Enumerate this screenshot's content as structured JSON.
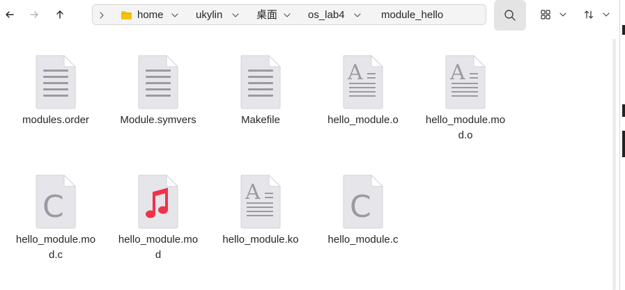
{
  "toolbar": {
    "back_icon": "arrow-left-icon",
    "forward_icon": "arrow-right-icon",
    "up_icon": "arrow-up-icon",
    "search_icon": "search-icon",
    "view_icon": "grid-view-icon",
    "sort_icon": "sort-icon"
  },
  "breadcrumb": {
    "items": [
      {
        "label": "home"
      },
      {
        "label": "ukylin"
      },
      {
        "label": "桌面"
      },
      {
        "label": "os_lab4"
      },
      {
        "label": "module_hello"
      }
    ]
  },
  "files": [
    {
      "name": "modules.order",
      "icon": "text-document-icon"
    },
    {
      "name": "Module.symvers",
      "icon": "text-document-icon"
    },
    {
      "name": "Makefile",
      "icon": "text-document-icon"
    },
    {
      "name": "hello_module.o",
      "icon": "object-file-icon"
    },
    {
      "name": "hello_module.mod.o",
      "icon": "object-file-icon"
    },
    {
      "name": "hello_module.mod.c",
      "icon": "c-source-icon"
    },
    {
      "name": "hello_module.mod",
      "icon": "music-file-icon"
    },
    {
      "name": "hello_module.ko",
      "icon": "object-file-icon"
    },
    {
      "name": "hello_module.c",
      "icon": "c-source-icon"
    }
  ],
  "colors": {
    "folder": "#f5c211",
    "music": "#f0334a",
    "page": "#e6e6ea",
    "ink": "#9a9a9f"
  }
}
